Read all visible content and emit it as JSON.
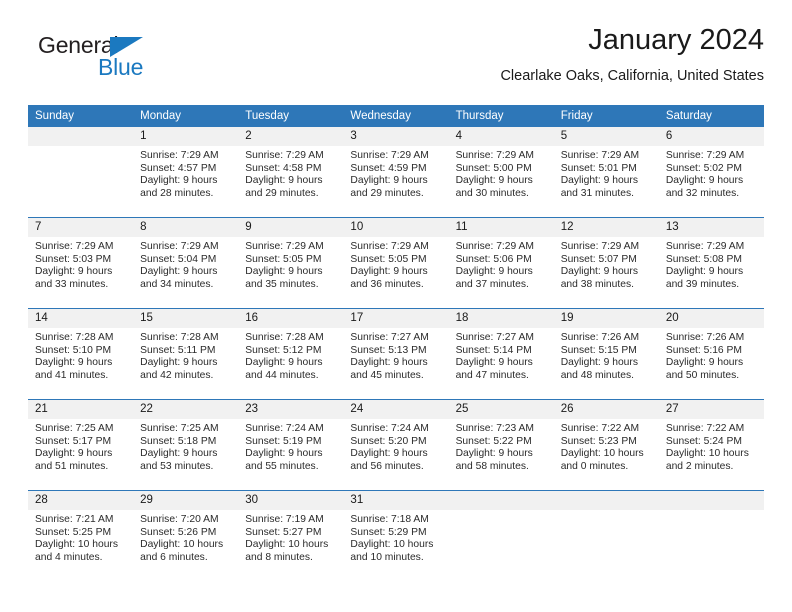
{
  "brand": {
    "word_one": "General",
    "word_two": "Blue",
    "accent_color": "#1b79c0",
    "triangle_icon": "triangle-icon"
  },
  "header": {
    "title": "January 2024",
    "subtitle": "Clearlake Oaks, California, United States"
  },
  "calendar": {
    "header_bg": "#2e77b8",
    "daynum_bg": "#f1f1f1",
    "weekdays": [
      "Sunday",
      "Monday",
      "Tuesday",
      "Wednesday",
      "Thursday",
      "Friday",
      "Saturday"
    ],
    "weeks": [
      [
        {
          "day": "",
          "sunrise": "",
          "sunset": "",
          "daylight": ""
        },
        {
          "day": "1",
          "sunrise": "Sunrise: 7:29 AM",
          "sunset": "Sunset: 4:57 PM",
          "daylight": "Daylight: 9 hours and 28 minutes."
        },
        {
          "day": "2",
          "sunrise": "Sunrise: 7:29 AM",
          "sunset": "Sunset: 4:58 PM",
          "daylight": "Daylight: 9 hours and 29 minutes."
        },
        {
          "day": "3",
          "sunrise": "Sunrise: 7:29 AM",
          "sunset": "Sunset: 4:59 PM",
          "daylight": "Daylight: 9 hours and 29 minutes."
        },
        {
          "day": "4",
          "sunrise": "Sunrise: 7:29 AM",
          "sunset": "Sunset: 5:00 PM",
          "daylight": "Daylight: 9 hours and 30 minutes."
        },
        {
          "day": "5",
          "sunrise": "Sunrise: 7:29 AM",
          "sunset": "Sunset: 5:01 PM",
          "daylight": "Daylight: 9 hours and 31 minutes."
        },
        {
          "day": "6",
          "sunrise": "Sunrise: 7:29 AM",
          "sunset": "Sunset: 5:02 PM",
          "daylight": "Daylight: 9 hours and 32 minutes."
        }
      ],
      [
        {
          "day": "7",
          "sunrise": "Sunrise: 7:29 AM",
          "sunset": "Sunset: 5:03 PM",
          "daylight": "Daylight: 9 hours and 33 minutes."
        },
        {
          "day": "8",
          "sunrise": "Sunrise: 7:29 AM",
          "sunset": "Sunset: 5:04 PM",
          "daylight": "Daylight: 9 hours and 34 minutes."
        },
        {
          "day": "9",
          "sunrise": "Sunrise: 7:29 AM",
          "sunset": "Sunset: 5:05 PM",
          "daylight": "Daylight: 9 hours and 35 minutes."
        },
        {
          "day": "10",
          "sunrise": "Sunrise: 7:29 AM",
          "sunset": "Sunset: 5:05 PM",
          "daylight": "Daylight: 9 hours and 36 minutes."
        },
        {
          "day": "11",
          "sunrise": "Sunrise: 7:29 AM",
          "sunset": "Sunset: 5:06 PM",
          "daylight": "Daylight: 9 hours and 37 minutes."
        },
        {
          "day": "12",
          "sunrise": "Sunrise: 7:29 AM",
          "sunset": "Sunset: 5:07 PM",
          "daylight": "Daylight: 9 hours and 38 minutes."
        },
        {
          "day": "13",
          "sunrise": "Sunrise: 7:29 AM",
          "sunset": "Sunset: 5:08 PM",
          "daylight": "Daylight: 9 hours and 39 minutes."
        }
      ],
      [
        {
          "day": "14",
          "sunrise": "Sunrise: 7:28 AM",
          "sunset": "Sunset: 5:10 PM",
          "daylight": "Daylight: 9 hours and 41 minutes."
        },
        {
          "day": "15",
          "sunrise": "Sunrise: 7:28 AM",
          "sunset": "Sunset: 5:11 PM",
          "daylight": "Daylight: 9 hours and 42 minutes."
        },
        {
          "day": "16",
          "sunrise": "Sunrise: 7:28 AM",
          "sunset": "Sunset: 5:12 PM",
          "daylight": "Daylight: 9 hours and 44 minutes."
        },
        {
          "day": "17",
          "sunrise": "Sunrise: 7:27 AM",
          "sunset": "Sunset: 5:13 PM",
          "daylight": "Daylight: 9 hours and 45 minutes."
        },
        {
          "day": "18",
          "sunrise": "Sunrise: 7:27 AM",
          "sunset": "Sunset: 5:14 PM",
          "daylight": "Daylight: 9 hours and 47 minutes."
        },
        {
          "day": "19",
          "sunrise": "Sunrise: 7:26 AM",
          "sunset": "Sunset: 5:15 PM",
          "daylight": "Daylight: 9 hours and 48 minutes."
        },
        {
          "day": "20",
          "sunrise": "Sunrise: 7:26 AM",
          "sunset": "Sunset: 5:16 PM",
          "daylight": "Daylight: 9 hours and 50 minutes."
        }
      ],
      [
        {
          "day": "21",
          "sunrise": "Sunrise: 7:25 AM",
          "sunset": "Sunset: 5:17 PM",
          "daylight": "Daylight: 9 hours and 51 minutes."
        },
        {
          "day": "22",
          "sunrise": "Sunrise: 7:25 AM",
          "sunset": "Sunset: 5:18 PM",
          "daylight": "Daylight: 9 hours and 53 minutes."
        },
        {
          "day": "23",
          "sunrise": "Sunrise: 7:24 AM",
          "sunset": "Sunset: 5:19 PM",
          "daylight": "Daylight: 9 hours and 55 minutes."
        },
        {
          "day": "24",
          "sunrise": "Sunrise: 7:24 AM",
          "sunset": "Sunset: 5:20 PM",
          "daylight": "Daylight: 9 hours and 56 minutes."
        },
        {
          "day": "25",
          "sunrise": "Sunrise: 7:23 AM",
          "sunset": "Sunset: 5:22 PM",
          "daylight": "Daylight: 9 hours and 58 minutes."
        },
        {
          "day": "26",
          "sunrise": "Sunrise: 7:22 AM",
          "sunset": "Sunset: 5:23 PM",
          "daylight": "Daylight: 10 hours and 0 minutes."
        },
        {
          "day": "27",
          "sunrise": "Sunrise: 7:22 AM",
          "sunset": "Sunset: 5:24 PM",
          "daylight": "Daylight: 10 hours and 2 minutes."
        }
      ],
      [
        {
          "day": "28",
          "sunrise": "Sunrise: 7:21 AM",
          "sunset": "Sunset: 5:25 PM",
          "daylight": "Daylight: 10 hours and 4 minutes."
        },
        {
          "day": "29",
          "sunrise": "Sunrise: 7:20 AM",
          "sunset": "Sunset: 5:26 PM",
          "daylight": "Daylight: 10 hours and 6 minutes."
        },
        {
          "day": "30",
          "sunrise": "Sunrise: 7:19 AM",
          "sunset": "Sunset: 5:27 PM",
          "daylight": "Daylight: 10 hours and 8 minutes."
        },
        {
          "day": "31",
          "sunrise": "Sunrise: 7:18 AM",
          "sunset": "Sunset: 5:29 PM",
          "daylight": "Daylight: 10 hours and 10 minutes."
        },
        {
          "day": "",
          "sunrise": "",
          "sunset": "",
          "daylight": ""
        },
        {
          "day": "",
          "sunrise": "",
          "sunset": "",
          "daylight": ""
        },
        {
          "day": "",
          "sunrise": "",
          "sunset": "",
          "daylight": ""
        }
      ]
    ]
  }
}
